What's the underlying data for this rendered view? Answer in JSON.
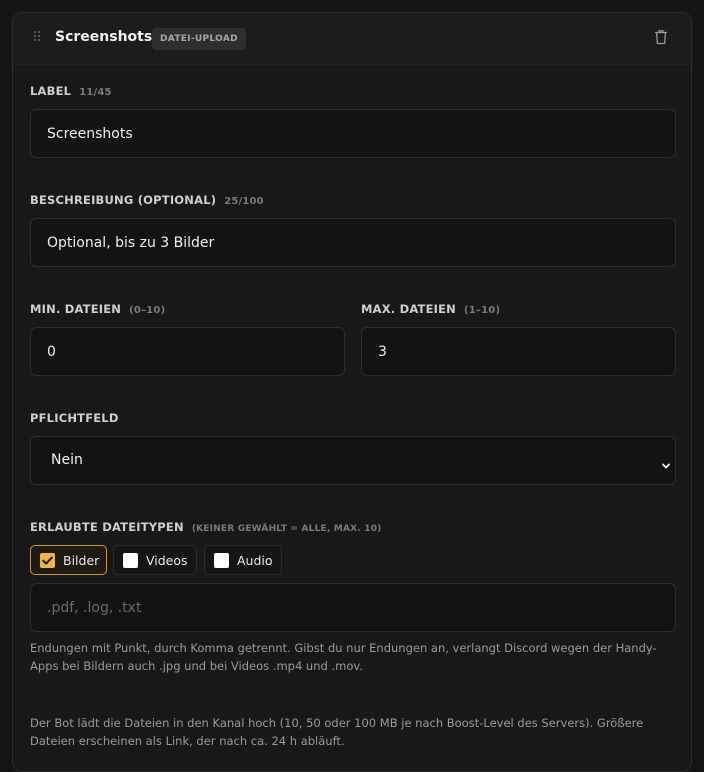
{
  "header": {
    "title": "Screenshots",
    "badge": "DATEI-UPLOAD"
  },
  "label_field": {
    "label": "LABEL",
    "counter": "11/45",
    "value": "Screenshots"
  },
  "description_field": {
    "label": "BESCHREIBUNG (OPTIONAL)",
    "counter": "25/100",
    "value": "Optional, bis zu 3 Bilder"
  },
  "min_files": {
    "label": "MIN. DATEIEN",
    "range": "(0–10)",
    "value": "0"
  },
  "max_files": {
    "label": "MAX. DATEIEN",
    "range": "(1–10)",
    "value": "3"
  },
  "required": {
    "label": "PFLICHTFELD",
    "selected": "Nein"
  },
  "file_types": {
    "label": "ERLAUBTE DATEITYPEN",
    "hint": "(KEINER GEWÄHLT = ALLE, MAX. 10)",
    "options": [
      {
        "label": "Bilder",
        "checked": true
      },
      {
        "label": "Videos",
        "checked": false
      },
      {
        "label": "Audio",
        "checked": false
      }
    ],
    "extensions_placeholder": ".pdf, .log, .txt",
    "extensions_value": ""
  },
  "help": {
    "extensions_note": "Endungen mit Punkt, durch Komma getrennt. Gibst du nur Endungen an, verlangt Discord wegen der Handy-Apps bei Bildern auch .jpg und bei Videos .mp4 und .mov.",
    "upload_note": "Der Bot lädt die Dateien in den Kanal hoch (10, 50 oder 100 MB je nach Boost-Level des Servers). Größere Dateien erscheinen als Link, der nach ca. 24 h abläuft."
  },
  "colors": {
    "accent": "#f0b447",
    "accent_border": "#d39a2e",
    "background": "#181818",
    "input_background": "#131313"
  },
  "icons": {
    "drag": "drag-handle-icon",
    "delete": "trash-icon",
    "dropdown": "chevron-down-icon",
    "checkmark": "checkmark-icon"
  }
}
